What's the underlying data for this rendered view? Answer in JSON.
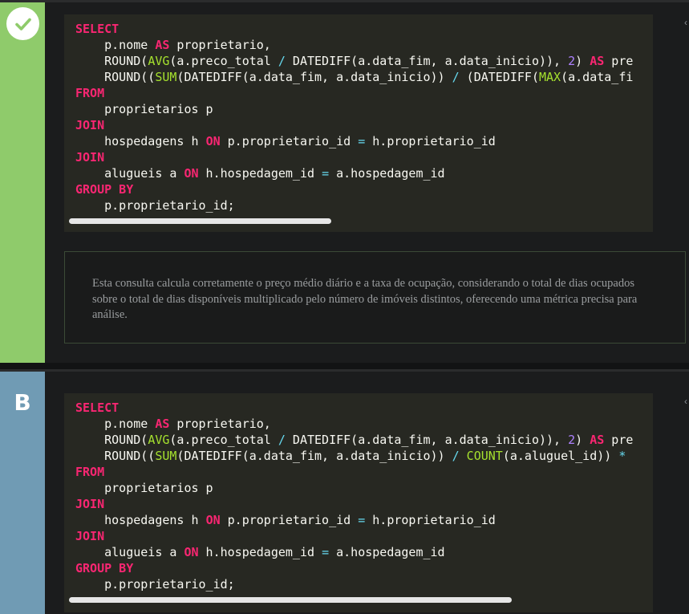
{
  "options": [
    {
      "status": "correct",
      "indicator_icon": "check-icon",
      "code_lines": [
        [
          [
            "kw",
            "SELECT"
          ]
        ],
        [
          [
            "t",
            "    p.nome "
          ],
          [
            "kw",
            "AS"
          ],
          [
            "t",
            " proprietario,"
          ]
        ],
        [
          [
            "t",
            "    ROUND("
          ],
          [
            "fn",
            "AVG"
          ],
          [
            "t",
            "(a.preco_total "
          ],
          [
            "sym",
            "/"
          ],
          [
            "t",
            " DATEDIFF(a.data_fim, a.data_inicio)), "
          ],
          [
            "num",
            "2"
          ],
          [
            "t",
            ") "
          ],
          [
            "kw",
            "AS"
          ],
          [
            "t",
            " pre"
          ]
        ],
        [
          [
            "t",
            "    ROUND(("
          ],
          [
            "fn",
            "SUM"
          ],
          [
            "t",
            "(DATEDIFF(a.data_fim, a.data_inicio)) "
          ],
          [
            "sym",
            "/"
          ],
          [
            "t",
            " (DATEDIFF("
          ],
          [
            "fn",
            "MAX"
          ],
          [
            "t",
            "(a.data_fi"
          ]
        ],
        [
          [
            "kw",
            "FROM"
          ]
        ],
        [
          [
            "t",
            "    proprietarios p"
          ]
        ],
        [
          [
            "kw",
            "JOIN"
          ]
        ],
        [
          [
            "t",
            "    hospedagens h "
          ],
          [
            "kw",
            "ON"
          ],
          [
            "t",
            " p.proprietario_id "
          ],
          [
            "sym",
            "="
          ],
          [
            "t",
            " h.proprietario_id"
          ]
        ],
        [
          [
            "kw",
            "JOIN"
          ]
        ],
        [
          [
            "t",
            "    alugueis a "
          ],
          [
            "kw",
            "ON"
          ],
          [
            "t",
            " h.hospedagem_id "
          ],
          [
            "sym",
            "="
          ],
          [
            "t",
            " a.hospedagem_id"
          ]
        ],
        [
          [
            "kw",
            "GROUP BY"
          ]
        ],
        [
          [
            "t",
            "    p.proprietario_id;"
          ]
        ]
      ],
      "scroll_fraction": 0.45,
      "explanation": "Esta consulta calcula corretamente o preço médio diário e a taxa de ocupação, considerando o total de dias ocupados sobre o total de dias disponíveis multiplicado pelo número de imóveis distintos, oferecendo uma métrica precisa para análise."
    },
    {
      "label": "B",
      "code_lines": [
        [
          [
            "kw",
            "SELECT"
          ]
        ],
        [
          [
            "t",
            "    p.nome "
          ],
          [
            "kw",
            "AS"
          ],
          [
            "t",
            " proprietario,"
          ]
        ],
        [
          [
            "t",
            "    ROUND("
          ],
          [
            "fn",
            "AVG"
          ],
          [
            "t",
            "(a.preco_total "
          ],
          [
            "sym",
            "/"
          ],
          [
            "t",
            " DATEDIFF(a.data_fim, a.data_inicio)), "
          ],
          [
            "num",
            "2"
          ],
          [
            "t",
            ") "
          ],
          [
            "kw",
            "AS"
          ],
          [
            "t",
            " pre"
          ]
        ],
        [
          [
            "t",
            "    ROUND(("
          ],
          [
            "fn",
            "SUM"
          ],
          [
            "t",
            "(DATEDIFF(a.data_fim, a.data_inicio)) "
          ],
          [
            "sym",
            "/"
          ],
          [
            "t",
            " "
          ],
          [
            "fn",
            "COUNT"
          ],
          [
            "t",
            "(a.aluguel_id)) "
          ],
          [
            "sym",
            "*"
          ],
          [
            "t",
            " "
          ]
        ],
        [
          [
            "kw",
            "FROM"
          ]
        ],
        [
          [
            "t",
            "    proprietarios p"
          ]
        ],
        [
          [
            "kw",
            "JOIN"
          ]
        ],
        [
          [
            "t",
            "    hospedagens h "
          ],
          [
            "kw",
            "ON"
          ],
          [
            "t",
            " p.proprietario_id "
          ],
          [
            "sym",
            "="
          ],
          [
            "t",
            " h.proprietario_id"
          ]
        ],
        [
          [
            "kw",
            "JOIN"
          ]
        ],
        [
          [
            "t",
            "    alugueis a "
          ],
          [
            "kw",
            "ON"
          ],
          [
            "t",
            " h.hospedagem_id "
          ],
          [
            "sym",
            "="
          ],
          [
            "t",
            " a.hospedagem_id"
          ]
        ],
        [
          [
            "kw",
            "GROUP BY"
          ]
        ],
        [
          [
            "t",
            "    p.proprietario_id;"
          ]
        ]
      ],
      "scroll_fraction": 0.76
    }
  ],
  "colors": {
    "correct_stripe": "#8fcb6b",
    "option_b_stripe": "#709bb4",
    "keyword": "#f92672",
    "function": "#a6e22e",
    "number": "#ae81ff",
    "operator": "#66d9ef",
    "code_bg": "#272822"
  }
}
